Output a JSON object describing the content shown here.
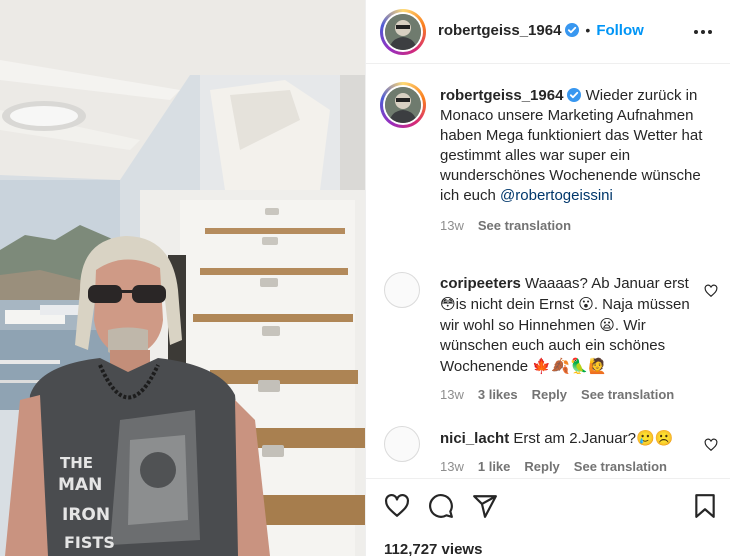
{
  "post": {
    "username": "robertgeiss_1964",
    "follow_label": "Follow",
    "separator": "•"
  },
  "caption": {
    "username": "robertgeiss_1964",
    "text": "Wieder zurück in Monaco unsere Marketing Aufnahmen haben Mega funktioniert das Wetter hat gestimmt alles war super ein wunderschönes Wochenende wünsche ich euch",
    "mention": "@robertogeissini",
    "time": "13w",
    "see_translation": "See translation"
  },
  "comments": [
    {
      "username": "coripeeters",
      "text_parts": [
        "Waaaas? Ab Januar erst ",
        "😳",
        "is nicht dein Ernst ",
        "😮",
        ". Naja müssen wir wohl so Hinnehmen ",
        "😦",
        ". Wir wünschen euch auch ein schönes Wochenende ",
        "🍁🍂🦜🙋"
      ],
      "time": "13w",
      "likes": "3 likes",
      "reply": "Reply",
      "see_translation": "See translation"
    },
    {
      "username": "nici_lacht",
      "text_parts": [
        "Erst am 2.Januar?",
        "🥲☹️"
      ],
      "time": "13w",
      "likes": "1 like",
      "reply": "Reply",
      "see_translation": "See translation"
    }
  ],
  "stats": {
    "views": "112,727 views"
  },
  "icons": {
    "more": "more-horizontal-icon",
    "verified": "verified-badge-icon",
    "like": "heart-icon",
    "comment": "comment-icon",
    "share": "share-icon",
    "save": "bookmark-icon"
  },
  "colors": {
    "accent": "#0095f6",
    "mention": "#00376b",
    "muted": "#8e8e8e",
    "verified": "#3897f0"
  },
  "media": {
    "shirt_text": [
      "THE",
      "MAN",
      "IRON",
      "FISTS"
    ]
  }
}
